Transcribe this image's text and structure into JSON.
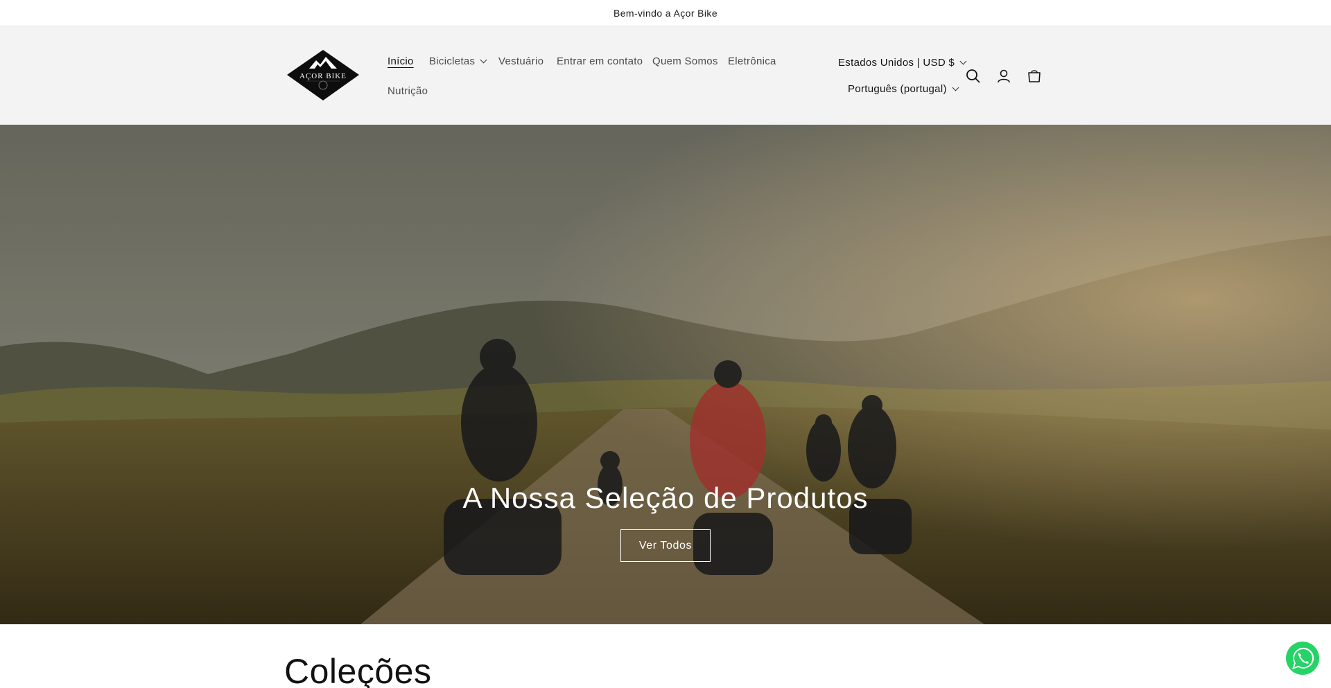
{
  "announcement": {
    "text": "Bem-vindo a Açor Bike"
  },
  "header": {
    "logo_text": "AÇOR BIKE",
    "nav": [
      {
        "label": "Início",
        "active": true
      },
      {
        "label": "Bicicletas",
        "has_dropdown": true
      },
      {
        "label": "Vestuário"
      },
      {
        "label": "Entrar em contato"
      },
      {
        "label": "Quem Somos"
      },
      {
        "label": "Eletrônica"
      },
      {
        "label": "Nutrição"
      }
    ],
    "country_selector": "Estados Unidos | USD $",
    "language_selector": "Português (portugal)",
    "icons": [
      "search-icon",
      "account-icon",
      "cart-icon"
    ]
  },
  "hero": {
    "title": "A Nossa Seleção de Produtos",
    "button_label": "Ver Todos"
  },
  "collections": {
    "title": "Coleções"
  },
  "floating": {
    "icon": "whatsapp-icon",
    "color": "#25d366"
  }
}
